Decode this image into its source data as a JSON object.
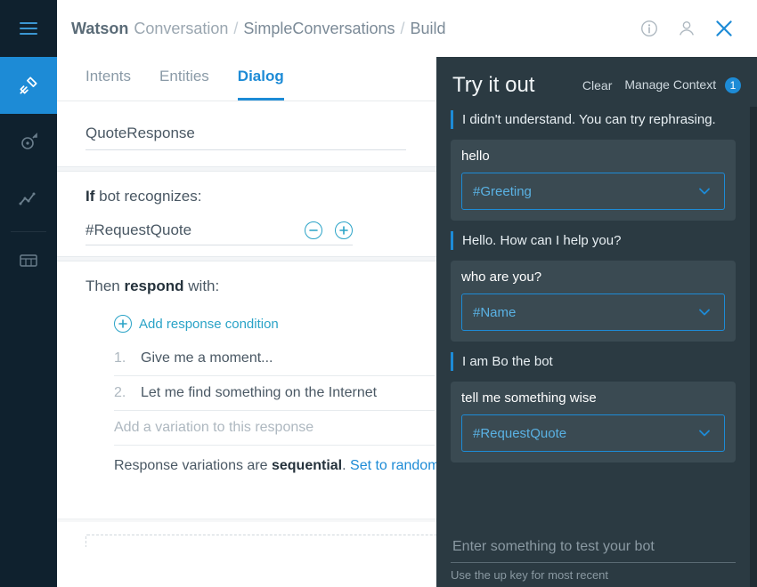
{
  "brand": {
    "strong": "Watson",
    "light": "Conversation"
  },
  "breadcrumb": {
    "sep": "/",
    "project": "SimpleConversations",
    "page": "Build"
  },
  "tabs": {
    "intents": "Intents",
    "entities": "Entities",
    "dialog": "Dialog",
    "active": "dialog"
  },
  "editor": {
    "node_name": "QuoteResponse",
    "if_label_prefix": "If",
    "if_label_suffix": "bot recognizes:",
    "condition_value": "#RequestQuote",
    "then_prefix": "Then",
    "then_strong": "respond",
    "then_suffix": "with:",
    "add_condition": "Add response condition",
    "responses": [
      {
        "n": "1.",
        "text": "Give me a moment..."
      },
      {
        "n": "2.",
        "text": "Let me find something on the Internet"
      }
    ],
    "variation_placeholder": "Add a variation to this response",
    "seq_prefix": "Response variations are ",
    "seq_strong": "sequential",
    "seq_period": ". ",
    "seq_link": "Set to random"
  },
  "panel": {
    "title": "Try it out",
    "clear": "Clear",
    "manage": "Manage Context",
    "manage_badge": "1",
    "stream": [
      {
        "type": "bot",
        "text": "I didn't understand. You can try rephrasing."
      },
      {
        "type": "user",
        "text": "hello",
        "intent": "#Greeting"
      },
      {
        "type": "bot",
        "text": "Hello. How can I help you?"
      },
      {
        "type": "user",
        "text": "who are you?",
        "intent": "#Name"
      },
      {
        "type": "bot",
        "text": "I am Bo the bot"
      },
      {
        "type": "user",
        "text": "tell me something wise",
        "intent": "#RequestQuote"
      }
    ],
    "input_placeholder": "Enter something to test your bot",
    "hint": "Use the up key for most recent"
  }
}
